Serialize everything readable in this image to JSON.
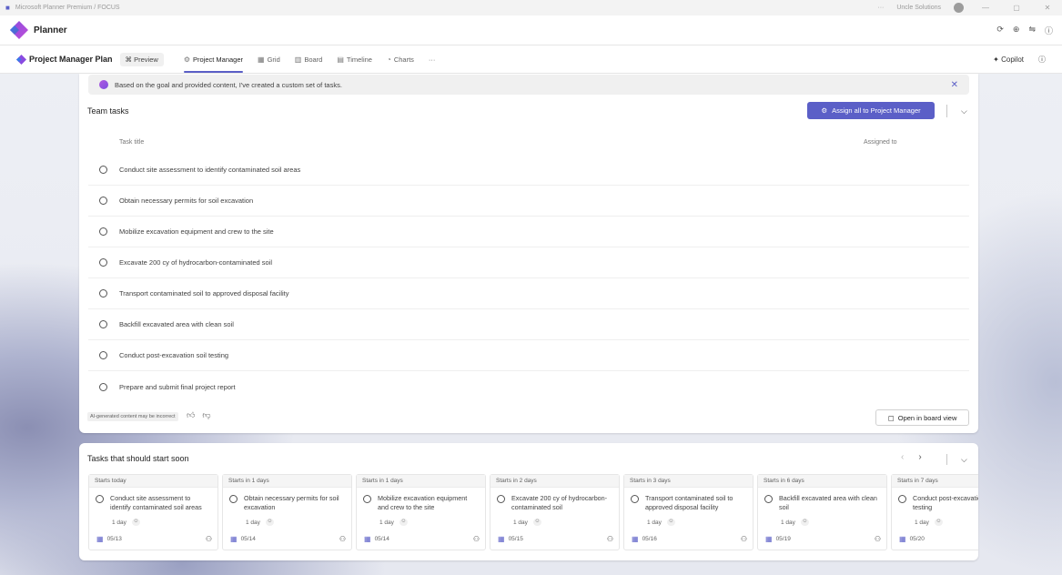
{
  "window": {
    "title": "Microsoft Planner Premium / FOCUS",
    "user_name": "Uncle Solutions",
    "controls": [
      "—",
      "▢",
      "✕"
    ]
  },
  "app": {
    "name": "Planner",
    "header_icons": [
      "refresh-icon",
      "globe-icon",
      "share-icon",
      "info-icon"
    ]
  },
  "plan": {
    "title": "Project Manager Plan",
    "preview_label": "Preview",
    "tabs": [
      {
        "label": "Project Manager",
        "icon": "copilot-icon",
        "active": true
      },
      {
        "label": "Grid",
        "icon": "grid-icon",
        "active": false
      },
      {
        "label": "Board",
        "icon": "board-icon",
        "active": false
      },
      {
        "label": "Timeline",
        "icon": "timeline-icon",
        "active": false
      },
      {
        "label": "Charts",
        "icon": "chart-icon",
        "active": false
      }
    ],
    "more_label": "···",
    "copilot_label": "Copilot"
  },
  "banner": {
    "text": "Based on the goal and provided content, I've created a custom set of tasks."
  },
  "team_tasks": {
    "title": "Team tasks",
    "assign_all_label": "Assign all to Project Manager",
    "col_task_title": "Task title",
    "col_assigned_to": "Assigned to",
    "tasks": [
      "Conduct site assessment to identify contaminated soil areas",
      "Obtain necessary permits for soil excavation",
      "Mobilize excavation equipment and crew to the site",
      "Excavate 200 cy of hydrocarbon-contaminated soil",
      "Transport contaminated soil to approved disposal facility",
      "Backfill excavated area with clean soil",
      "Conduct post-excavation soil testing",
      "Prepare and submit final project report"
    ],
    "ai_note": "AI-generated content may be incorrect",
    "open_board_label": "Open in board view"
  },
  "start_soon": {
    "title": "Tasks that should start soon",
    "cards": [
      {
        "start": "Starts today",
        "title": "Conduct site assessment to identify contaminated soil areas",
        "duration": "1 day",
        "date": "05/13"
      },
      {
        "start": "Starts in 1 days",
        "title": "Obtain necessary permits for soil excavation",
        "duration": "1 day",
        "date": "05/14"
      },
      {
        "start": "Starts in 1 days",
        "title": "Mobilize excavation equipment and crew to the site",
        "duration": "1 day",
        "date": "05/14"
      },
      {
        "start": "Starts in 2 days",
        "title": "Excavate 200 cy of hydrocarbon-contaminated soil",
        "duration": "1 day",
        "date": "05/15"
      },
      {
        "start": "Starts in 3 days",
        "title": "Transport contaminated soil to approved disposal facility",
        "duration": "1 day",
        "date": "05/16"
      },
      {
        "start": "Starts in 6 days",
        "title": "Backfill excavated area with clean soil",
        "duration": "1 day",
        "date": "05/19"
      },
      {
        "start": "Starts in 7 days",
        "title": "Conduct post-excavation soil testing",
        "duration": "1 day",
        "date": "05/20"
      }
    ]
  },
  "colors": {
    "accent": "#5b5fc7",
    "banner_bg": "#f0f0f0"
  }
}
